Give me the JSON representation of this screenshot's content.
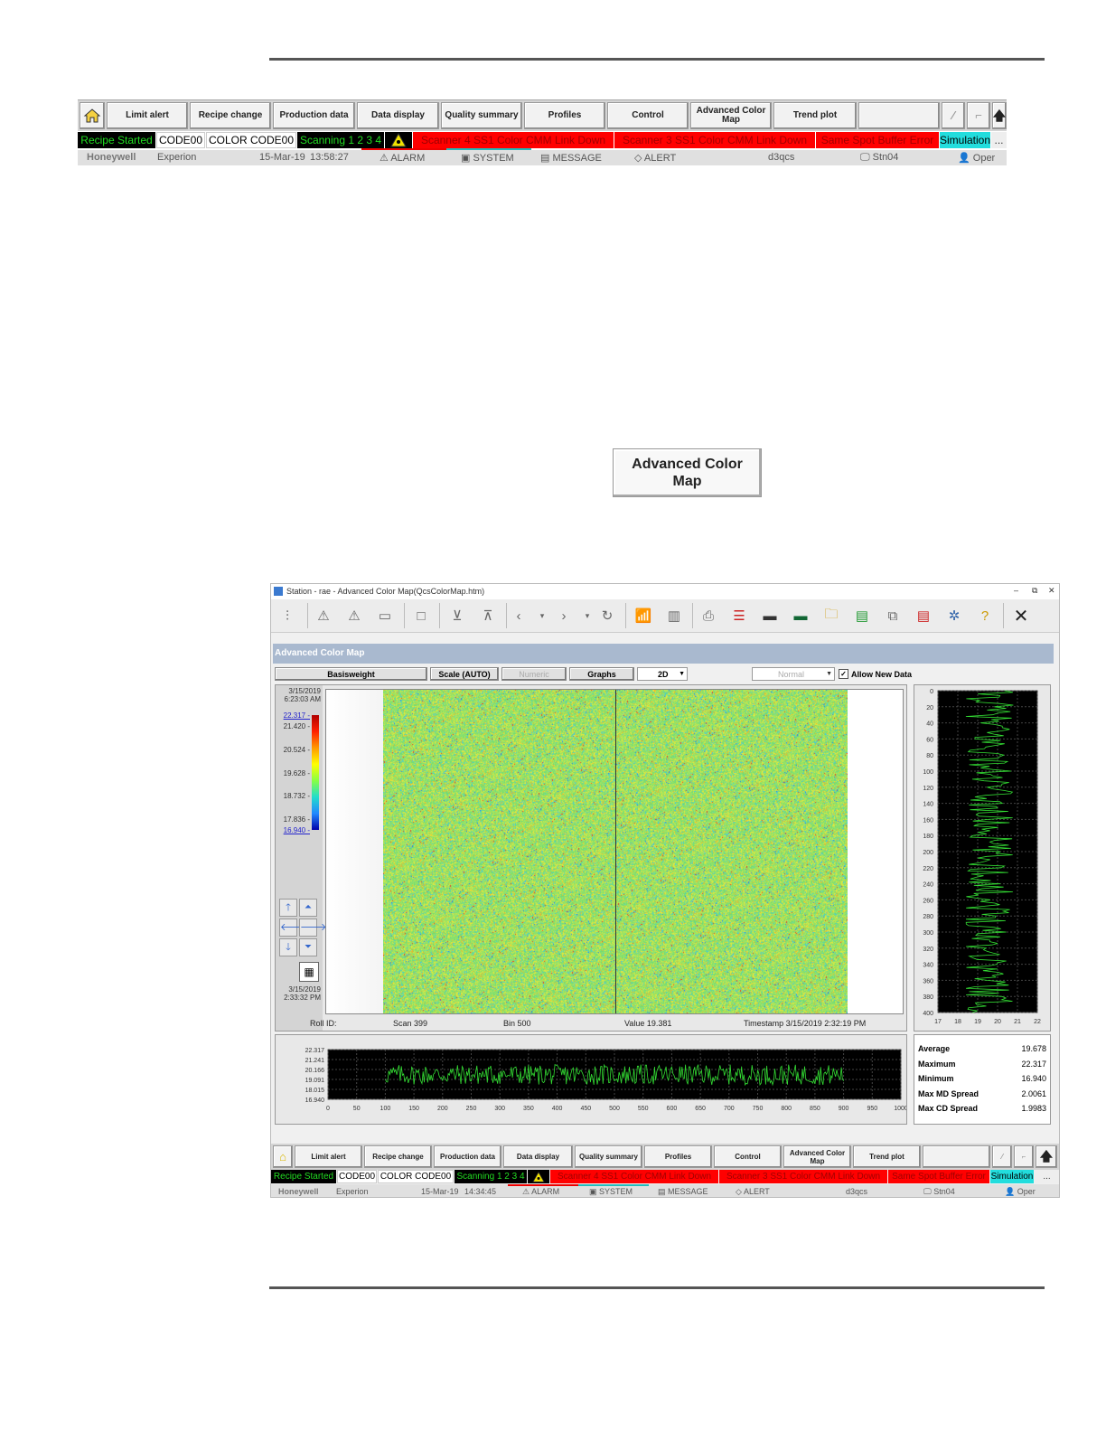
{
  "nav": {
    "buttons": [
      "Limit alert",
      "Recipe change",
      "Production data",
      "Data display",
      "Quality summary",
      "Profiles",
      "Control",
      "Advanced Color Map",
      "Trend plot"
    ],
    "status": {
      "recipe": "Recipe Started",
      "code": "CODE00",
      "color_code": "COLOR CODE00",
      "scanning": "Scanning 1 2 3 4",
      "alarm1": "Scanner 4 SS1 Color CMM Link Down",
      "alarm2": "Scanner 3 SS1 Color CMM Link Down",
      "alarm3": "Same Spot Buffer Error",
      "mode": "Simulation",
      "more": "..."
    },
    "info": {
      "brand": "Honeywell",
      "product": "Experion",
      "date": "15-Mar-19",
      "time": "13:58:27",
      "alarm": "ALARM",
      "system": "SYSTEM",
      "message": "MESSAGE",
      "alert": "ALERT",
      "server": "d3qcs",
      "station": "Stn04",
      "user": "Oper"
    }
  },
  "big_button": {
    "line1": "Advanced Color",
    "line2": "Map"
  },
  "window": {
    "title": "Station - rae - Advanced Color Map(QcsColorMap.htm)",
    "header": "Advanced Color Map",
    "controls": {
      "measurement": "Basisweight",
      "scale": "Scale (AUTO)",
      "numeric": "Numeric",
      "graphs": "Graphs",
      "view": "2D",
      "mode": "Normal",
      "allow_new_data": "Allow New Data"
    },
    "legend": {
      "start_date": "3/15/2019",
      "start_time": "6:23:03 AM",
      "ticks": [
        "22.317",
        "21.420",
        "20.524",
        "19.628",
        "18.732",
        "17.836",
        "16.940"
      ],
      "end_date": "3/15/2019",
      "end_time": "2:33:32 PM"
    },
    "readout": {
      "roll": "Roll ID:",
      "scan": "Scan 399",
      "bin": "Bin 500",
      "value": "Value 19.381",
      "timestamp": "Timestamp 3/15/2019 2:32:19 PM"
    },
    "stats": [
      {
        "label": "Average",
        "value": "19.678"
      },
      {
        "label": "Maximum",
        "value": "22.317"
      },
      {
        "label": "Minimum",
        "value": "16.940"
      },
      {
        "label": "Max MD Spread",
        "value": "2.0061"
      },
      {
        "label": "Max CD Spread",
        "value": "1.9983"
      }
    ],
    "nav_info": {
      "date": "15-Mar-19",
      "time": "14:34:45"
    }
  },
  "chart_data": [
    {
      "type": "line",
      "title": "",
      "xlabel": "",
      "ylabel": "",
      "x_ticks": [
        0,
        50,
        100,
        150,
        200,
        250,
        300,
        350,
        400,
        450,
        500,
        550,
        600,
        650,
        700,
        750,
        800,
        850,
        900,
        950,
        1000
      ],
      "y_ticks": [
        "22.317",
        "21.241",
        "20.166",
        "19.091",
        "18.015",
        "16.940"
      ],
      "xlim": [
        0,
        1000
      ],
      "ylim": [
        16.94,
        22.317
      ],
      "data_range": [
        100,
        900
      ],
      "series_color": "#33dd33"
    },
    {
      "type": "line",
      "orientation": "vertical",
      "title": "",
      "y_ticks": [
        0,
        20,
        40,
        60,
        80,
        100,
        120,
        140,
        160,
        180,
        200,
        220,
        240,
        260,
        280,
        300,
        320,
        340,
        360,
        380,
        400
      ],
      "x_ticks": [
        17,
        18,
        19,
        20,
        21,
        22
      ],
      "xlim": [
        17,
        22
      ],
      "ylim": [
        0,
        400
      ],
      "series_color": "#33dd33"
    }
  ]
}
